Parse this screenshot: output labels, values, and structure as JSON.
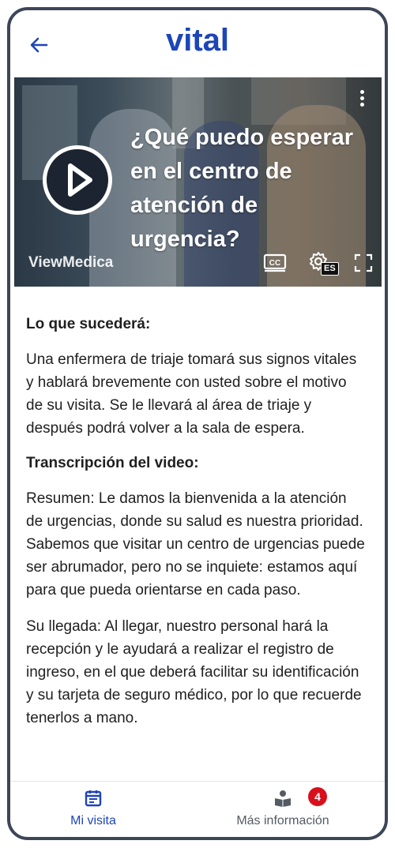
{
  "header": {
    "logo_text": "vital",
    "back_icon": "back-arrow-icon",
    "brand_color": "#1d45b8"
  },
  "video": {
    "title": "¿Qué puedo esperar en el centro de atención de urgencia?",
    "brand": "ViewMedica",
    "captions_language": "ES",
    "icons": [
      "more-vertical-icon",
      "play-icon",
      "closed-captions-icon",
      "settings-icon",
      "fullscreen-icon"
    ]
  },
  "content": {
    "section1_heading": "Lo que sucederá:",
    "section1_text": "Una enfermera de triaje tomará sus signos vitales y hablará brevemente con usted sobre el motivo de su visita. Se le llevará al área de triaje y después podrá volver a la sala de espera.",
    "section2_heading": "Transcripción del video:",
    "paragraph1": "Resumen: Le damos la bienvenida a la atención de urgencias, donde su salud es nuestra prioridad. Sabemos que visitar un centro de urgencias puede ser abrumador, pero no se inquiete: estamos aquí para que pueda orientarse en cada paso.",
    "paragraph2": "Su llegada: Al llegar, nuestro personal hará la recepción y le ayudará a realizar el registro de ingreso, en el que deberá facilitar su identificación y su tarjeta de seguro médico, por lo que recuerde tenerlos a mano."
  },
  "tabbar": {
    "tab1_label": "Mi visita",
    "tab1_icon": "calendar-icon",
    "tab2_label": "Más información",
    "tab2_icon": "book-reader-icon",
    "tab2_badge": "4",
    "active_color": "#1d45b8",
    "badge_color": "#d8101c"
  }
}
